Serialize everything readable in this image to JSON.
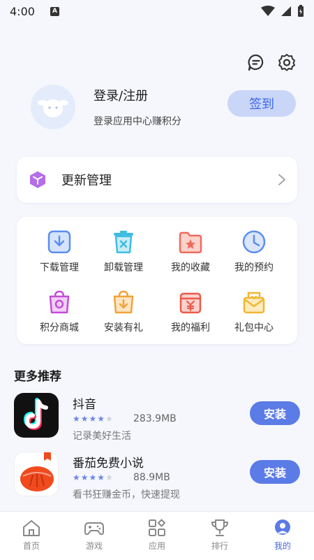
{
  "status_bar": {
    "time": "4:00",
    "notification_badge": "A"
  },
  "top_icons": [
    "message-icon",
    "settings-icon"
  ],
  "profile": {
    "title": "登录/注册",
    "subtitle": "登录应用中心赚积分",
    "checkin_label": "签到"
  },
  "update": {
    "label": "更新管理"
  },
  "grid": [
    {
      "label": "下载管理",
      "icon": "download-icon"
    },
    {
      "label": "卸载管理",
      "icon": "uninstall-icon"
    },
    {
      "label": "我的收藏",
      "icon": "favorites-icon"
    },
    {
      "label": "我的预约",
      "icon": "reservation-clock-icon"
    },
    {
      "label": "积分商城",
      "icon": "points-mall-bag-icon"
    },
    {
      "label": "安装有礼",
      "icon": "install-gift-icon"
    },
    {
      "label": "我的福利",
      "icon": "welfare-icon"
    },
    {
      "label": "礼包中心",
      "icon": "gift-pack-icon"
    }
  ],
  "section_title": "更多推荐",
  "apps": [
    {
      "name": "抖音",
      "rating": 4,
      "size": "283.9MB",
      "desc": "记录美好生活",
      "install_label": "安装"
    },
    {
      "name": "番茄免费小说",
      "rating": 4,
      "size": "88.9MB",
      "desc": "看书狂赚金币，快速提现",
      "install_label": "安装"
    }
  ],
  "nav": [
    {
      "label": "首页",
      "icon": "home-icon",
      "active": false
    },
    {
      "label": "游戏",
      "icon": "gamepad-icon",
      "active": false
    },
    {
      "label": "应用",
      "icon": "apps-grid-icon",
      "active": false
    },
    {
      "label": "排行",
      "icon": "trophy-icon",
      "active": false
    },
    {
      "label": "我的",
      "icon": "profile-icon",
      "active": true
    }
  ],
  "colors": {
    "accent": "#5b7be6",
    "checkin_bg": "#c9d6f7",
    "star_on": "#6d86e6"
  }
}
